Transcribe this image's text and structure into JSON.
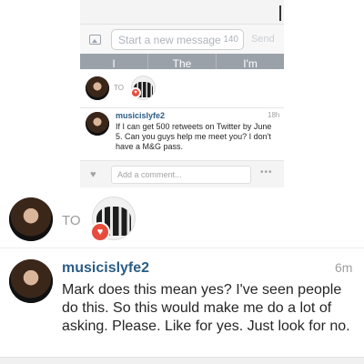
{
  "composer": {
    "placeholder": "Start a new message",
    "char_count": "140",
    "send_label": "Send"
  },
  "suggestions": [
    "I",
    "The",
    "I'm"
  ],
  "small_to_label": "TO",
  "small_post": {
    "username": "musicislyfe2",
    "time": "18h",
    "body": "If I can get 500 retweets on Twitter by June 5. Can you guys help me meet you? I don't have a M&G pass."
  },
  "comment_bar": {
    "placeholder": "Add a comment...",
    "more": "•••"
  },
  "to_label": "TO",
  "post": {
    "username": "musicislyfe2",
    "time": "6m",
    "body": "Mark does this mean yes? I've seen people do this. So this would make me do a lot of asking. Please. Like for yes. Just look for no."
  },
  "icons": {
    "heart": "♥",
    "photo": "photo-icon"
  },
  "colors": {
    "username": "#2b5d85",
    "heart_badge": "#e74c3c",
    "suggestion_bar": "#9aa1a9"
  }
}
